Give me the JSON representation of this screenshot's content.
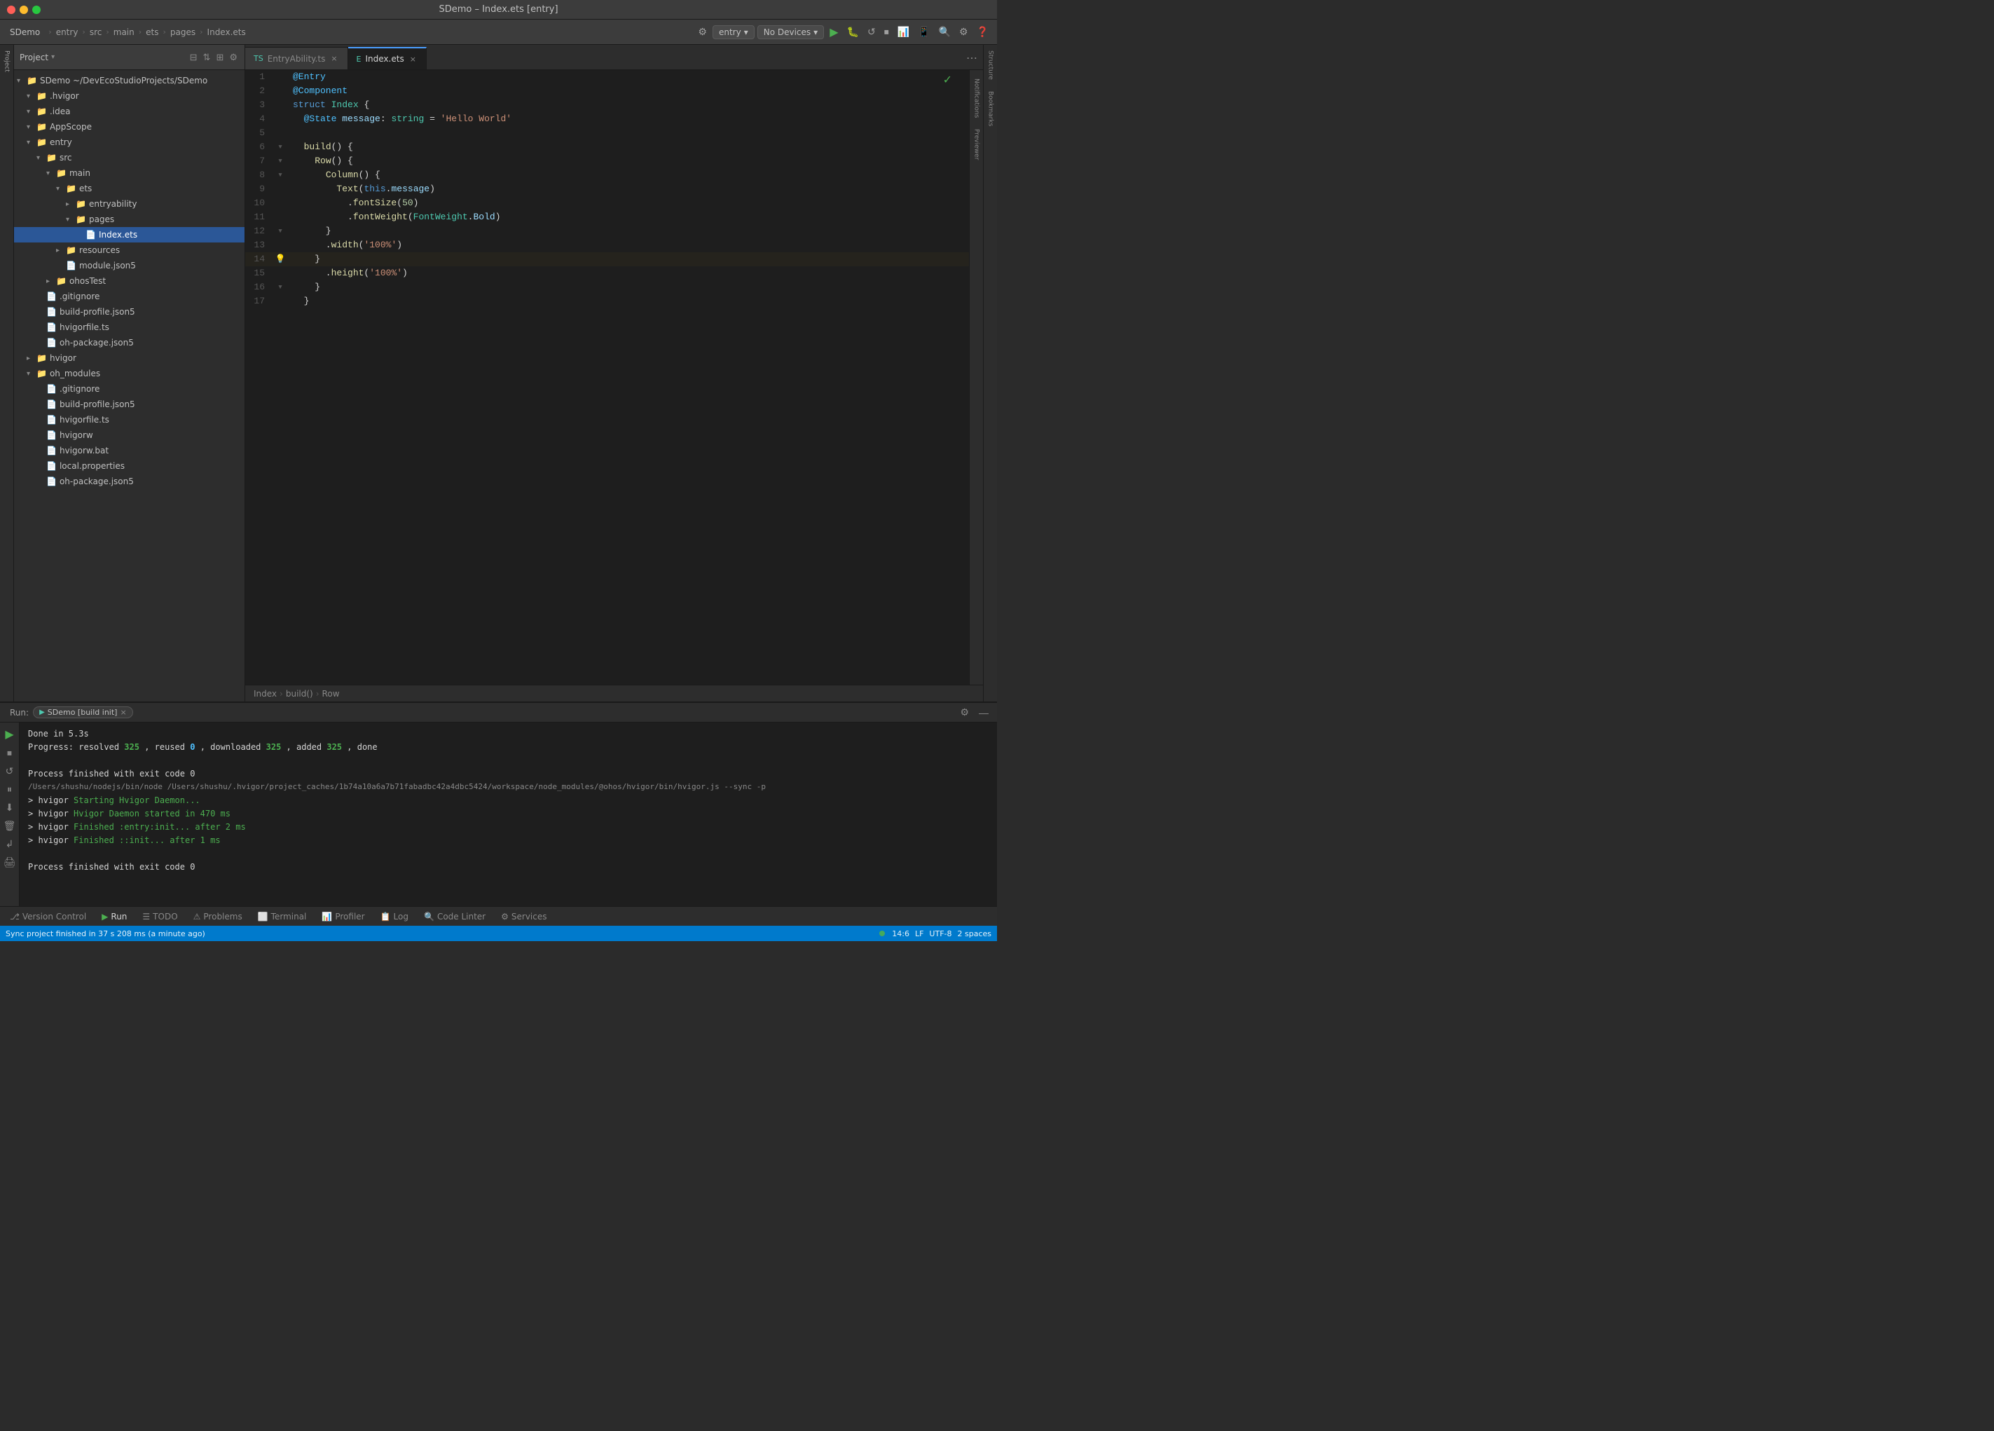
{
  "window": {
    "title": "SDemo – Index.ets [entry]",
    "traffic_lights": [
      "close",
      "minimize",
      "maximize"
    ]
  },
  "toolbar": {
    "project_label": "SDemo",
    "breadcrumb": [
      "SDemo",
      "entry",
      "src",
      "main",
      "ets",
      "pages",
      "Index.ets"
    ],
    "entry_label": "entry",
    "no_devices_label": "No Devices",
    "run_label": "▶",
    "settings_label": "⚙"
  },
  "project_panel": {
    "title": "Project",
    "tree": [
      {
        "id": 1,
        "indent": 0,
        "arrow": "▾",
        "icon": "📁",
        "label": "SDemo ~/DevEcoStudioProjects/SDemo",
        "type": "folder",
        "expanded": true
      },
      {
        "id": 2,
        "indent": 1,
        "arrow": "▾",
        "icon": "📁",
        "label": ".hvigor",
        "type": "folder",
        "expanded": true
      },
      {
        "id": 3,
        "indent": 1,
        "arrow": "▾",
        "icon": "📁",
        "label": ".idea",
        "type": "folder"
      },
      {
        "id": 4,
        "indent": 1,
        "arrow": "▾",
        "icon": "📁",
        "label": "AppScope",
        "type": "folder"
      },
      {
        "id": 5,
        "indent": 1,
        "arrow": "▾",
        "icon": "📁",
        "label": "entry",
        "type": "folder",
        "expanded": true
      },
      {
        "id": 6,
        "indent": 2,
        "arrow": "▾",
        "icon": "📁",
        "label": "src",
        "type": "folder",
        "expanded": true
      },
      {
        "id": 7,
        "indent": 3,
        "arrow": "▾",
        "icon": "📁",
        "label": "main",
        "type": "folder",
        "expanded": true
      },
      {
        "id": 8,
        "indent": 4,
        "arrow": "▾",
        "icon": "📁",
        "label": "ets",
        "type": "folder",
        "expanded": true
      },
      {
        "id": 9,
        "indent": 5,
        "arrow": "▸",
        "icon": "📁",
        "label": "entryability",
        "type": "folder"
      },
      {
        "id": 10,
        "indent": 5,
        "arrow": "▾",
        "icon": "📁",
        "label": "pages",
        "type": "folder",
        "expanded": true
      },
      {
        "id": 11,
        "indent": 6,
        "arrow": "",
        "icon": "📄",
        "label": "Index.ets",
        "type": "file-ts",
        "selected": true
      },
      {
        "id": 12,
        "indent": 4,
        "arrow": "▸",
        "icon": "📁",
        "label": "resources",
        "type": "folder"
      },
      {
        "id": 13,
        "indent": 4,
        "arrow": "",
        "icon": "📄",
        "label": "module.json5",
        "type": "file"
      },
      {
        "id": 14,
        "indent": 3,
        "arrow": "▸",
        "icon": "📁",
        "label": "ohosTest",
        "type": "folder"
      },
      {
        "id": 15,
        "indent": 2,
        "arrow": "",
        "icon": "📄",
        "label": ".gitignore",
        "type": "file"
      },
      {
        "id": 16,
        "indent": 2,
        "arrow": "",
        "icon": "📄",
        "label": "build-profile.json5",
        "type": "file"
      },
      {
        "id": 17,
        "indent": 2,
        "arrow": "",
        "icon": "📄",
        "label": "hvigorfile.ts",
        "type": "file-ts"
      },
      {
        "id": 18,
        "indent": 2,
        "arrow": "",
        "icon": "📄",
        "label": "oh-package.json5",
        "type": "file"
      },
      {
        "id": 19,
        "indent": 1,
        "arrow": "▸",
        "icon": "📁",
        "label": "hvigor",
        "type": "folder"
      },
      {
        "id": 20,
        "indent": 1,
        "arrow": "▾",
        "icon": "📁",
        "label": "oh_modules",
        "type": "folder",
        "expanded": true
      },
      {
        "id": 21,
        "indent": 2,
        "arrow": "",
        "icon": "📄",
        "label": ".gitignore",
        "type": "file"
      },
      {
        "id": 22,
        "indent": 2,
        "arrow": "",
        "icon": "📄",
        "label": "build-profile.json5",
        "type": "file"
      },
      {
        "id": 23,
        "indent": 2,
        "arrow": "",
        "icon": "📄",
        "label": "hvigorfile.ts",
        "type": "file-ts"
      },
      {
        "id": 24,
        "indent": 2,
        "arrow": "",
        "icon": "📄",
        "label": "hvigorw",
        "type": "file"
      },
      {
        "id": 25,
        "indent": 2,
        "arrow": "",
        "icon": "📄",
        "label": "hvigorw.bat",
        "type": "file"
      },
      {
        "id": 26,
        "indent": 2,
        "arrow": "",
        "icon": "📄",
        "label": "local.properties",
        "type": "file"
      },
      {
        "id": 27,
        "indent": 2,
        "arrow": "",
        "icon": "📄",
        "label": "oh-package.json5",
        "type": "file"
      }
    ]
  },
  "editor": {
    "tabs": [
      {
        "id": 1,
        "label": "EntryAbility.ts",
        "active": false,
        "icon": "ts"
      },
      {
        "id": 2,
        "label": "Index.ets",
        "active": true,
        "icon": "ets"
      }
    ],
    "lines": [
      {
        "num": 1,
        "code": "@Entry",
        "gutter": ""
      },
      {
        "num": 2,
        "code": "@Component",
        "gutter": ""
      },
      {
        "num": 3,
        "code": "struct Index {",
        "gutter": ""
      },
      {
        "num": 4,
        "code": "  @State message: string = 'Hello World'",
        "gutter": ""
      },
      {
        "num": 5,
        "code": "",
        "gutter": ""
      },
      {
        "num": 6,
        "code": "  build() {",
        "gutter": "▾"
      },
      {
        "num": 7,
        "code": "    Row() {",
        "gutter": "▾"
      },
      {
        "num": 8,
        "code": "      Column() {",
        "gutter": "▾"
      },
      {
        "num": 9,
        "code": "        Text(this.message)",
        "gutter": ""
      },
      {
        "num": 10,
        "code": "          .fontSize(50)",
        "gutter": ""
      },
      {
        "num": 11,
        "code": "          .fontWeight(FontWeight.Bold)",
        "gutter": ""
      },
      {
        "num": 12,
        "code": "      }",
        "gutter": "▾"
      },
      {
        "num": 13,
        "code": "      .width('100%')",
        "gutter": ""
      },
      {
        "num": 14,
        "code": "    }",
        "gutter": "💡"
      },
      {
        "num": 15,
        "code": "      .height('100%')",
        "gutter": ""
      },
      {
        "num": 16,
        "code": "    }",
        "gutter": "▾"
      },
      {
        "num": 17,
        "code": "  }",
        "gutter": ""
      }
    ],
    "breadcrumb": [
      "Index",
      "build()",
      "Row"
    ]
  },
  "bottom_panel": {
    "run_label": "Run:",
    "run_config": "SDemo [build init]",
    "console_lines": [
      {
        "type": "plain",
        "text": "Done in 5.3s"
      },
      {
        "type": "mixed",
        "prefix": "Progress: resolved ",
        "highlight1": "325",
        "mid1": ", reused ",
        "highlight2": "0",
        "mid2": ", downloaded ",
        "highlight3": "325",
        "mid3": ", added ",
        "highlight4": "325",
        "suffix": ", done"
      },
      {
        "type": "plain",
        "text": ""
      },
      {
        "type": "plain",
        "text": "Process finished with exit code 0"
      },
      {
        "type": "plain",
        "text": "/Users/shushu/nodejs/bin/node /Users/shushu/.hvigor/project_caches/1b74a10a6a7b71fabadbc42a4dbc5424/workspace/node_modules/@ohos/hvigor/bin/hvigor.js --sync -p"
      },
      {
        "type": "hvigor",
        "prefix": "> hvigor ",
        "text": "Starting Hvigor Daemon..."
      },
      {
        "type": "hvigor",
        "prefix": "> hvigor ",
        "text": "Hvigor Daemon started in 470 ms"
      },
      {
        "type": "hvigor",
        "prefix": "> hvigor ",
        "text": "Finished :entry:init... after 2 ms"
      },
      {
        "type": "hvigor",
        "prefix": "> hvigor ",
        "text": "Finished ::init... after 1 ms"
      },
      {
        "type": "plain",
        "text": ""
      },
      {
        "type": "plain",
        "text": "Process finished with exit code 0"
      }
    ],
    "footer_tabs": [
      {
        "label": "Version Control",
        "icon": "⎇",
        "active": false
      },
      {
        "label": "Run",
        "icon": "▶",
        "active": true
      },
      {
        "label": "TODO",
        "icon": "☰",
        "active": false
      },
      {
        "label": "Problems",
        "icon": "⚠",
        "active": false
      },
      {
        "label": "Terminal",
        "icon": "⬜",
        "active": false
      },
      {
        "label": "Profiler",
        "icon": "📊",
        "active": false
      },
      {
        "label": "Log",
        "icon": "📋",
        "active": false
      },
      {
        "label": "Code Linter",
        "icon": "🔍",
        "active": false
      },
      {
        "label": "Services",
        "icon": "⚙",
        "active": false
      }
    ]
  },
  "status_bar": {
    "sync_text": "Sync project finished in 37 s 208 ms (a minute ago)",
    "position": "14:6",
    "line_ending": "LF",
    "encoding": "UTF-8",
    "spaces": "2 spaces"
  },
  "right_sidebar": {
    "notifications_label": "Notifications",
    "previewer_label": "Previewer"
  },
  "structure_sidebar": {
    "structure_label": "Structure",
    "bookmarks_label": "Bookmarks"
  }
}
